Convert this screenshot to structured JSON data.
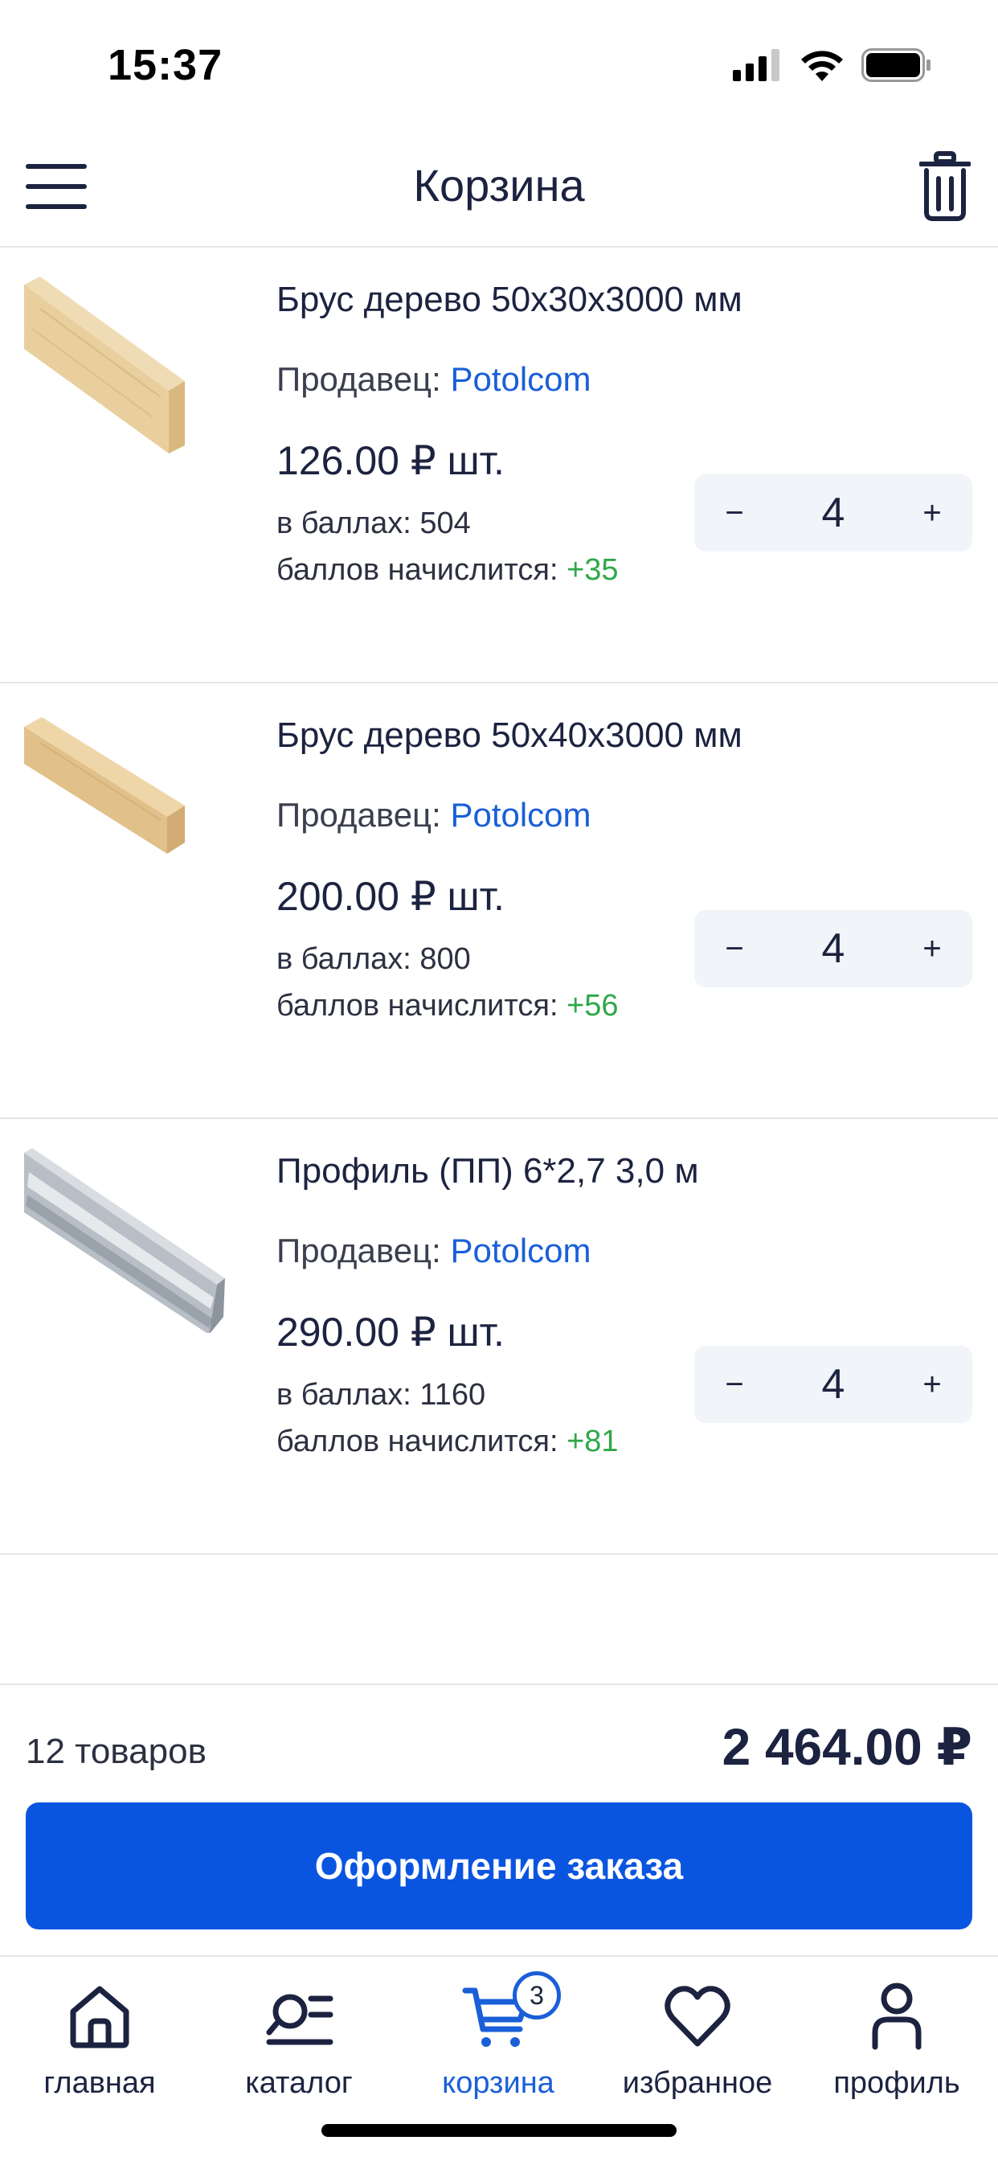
{
  "status_bar": {
    "time": "15:37"
  },
  "header": {
    "title": "Корзина"
  },
  "cart": {
    "items": [
      {
        "title": "Брус дерево 50х30х3000 мм",
        "seller_label": "Продавец:",
        "seller_name": "Potolcom",
        "price": "126.00 ₽ шт.",
        "points_label": "в баллах:",
        "points_value": "504",
        "accrual_label": "баллов начислится:",
        "accrual_value": "+35",
        "quantity": "4",
        "minus": "−",
        "plus": "+"
      },
      {
        "title": "Брус дерево 50х40х3000 мм",
        "seller_label": "Продавец:",
        "seller_name": "Potolcom",
        "price": "200.00 ₽ шт.",
        "points_label": "в баллах:",
        "points_value": "800",
        "accrual_label": "баллов начислится:",
        "accrual_value": "+56",
        "quantity": "4",
        "minus": "−",
        "plus": "+"
      },
      {
        "title": "Профиль (ПП) 6*2,7 3,0 м",
        "seller_label": "Продавец:",
        "seller_name": "Potolcom",
        "price": "290.00 ₽ шт.",
        "points_label": "в баллах:",
        "points_value": "1160",
        "accrual_label": "баллов начислится:",
        "accrual_value": "+81",
        "quantity": "4",
        "minus": "−",
        "plus": "+"
      }
    ]
  },
  "summary": {
    "count": "12 товаров",
    "total": "2 464.00 ₽",
    "checkout_label": "Оформление заказа"
  },
  "tab_bar": {
    "items": [
      {
        "label": "главная",
        "icon": "home-icon"
      },
      {
        "label": "каталог",
        "icon": "catalog-icon"
      },
      {
        "label": "корзина",
        "icon": "cart-icon",
        "badge": "3",
        "active": true
      },
      {
        "label": "избранное",
        "icon": "heart-icon"
      },
      {
        "label": "профиль",
        "icon": "profile-icon"
      }
    ]
  },
  "colors": {
    "accent": "#0a55e0",
    "link": "#1a5fd8",
    "points_green": "#2ea84a",
    "text_dark": "#1c2340",
    "stepper_bg": "#f1f4f8"
  }
}
